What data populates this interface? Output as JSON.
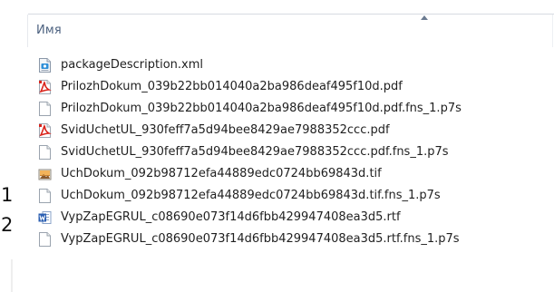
{
  "column_header": {
    "name_label": "Имя"
  },
  "side_numbers": [
    "1",
    "2"
  ],
  "files": [
    {
      "name": "packageDescription.xml",
      "icon": "xml-file-icon"
    },
    {
      "name": "PrilozhDokum_039b22bb014040a2ba986deaf495f10d.pdf",
      "icon": "pdf-file-icon"
    },
    {
      "name": "PrilozhDokum_039b22bb014040a2ba986deaf495f10d.pdf.fns_1.p7s",
      "icon": "blank-file-icon"
    },
    {
      "name": "SvidUchetUL_930feff7a5d94bee8429ae7988352ccc.pdf",
      "icon": "pdf-file-icon"
    },
    {
      "name": "SvidUchetUL_930feff7a5d94bee8429ae7988352ccc.pdf.fns_1.p7s",
      "icon": "blank-file-icon"
    },
    {
      "name": "UchDokum_092b98712efa44889edc0724bb69843d.tif",
      "icon": "image-file-icon"
    },
    {
      "name": "UchDokum_092b98712efa44889edc0724bb69843d.tif.fns_1.p7s",
      "icon": "blank-file-icon"
    },
    {
      "name": "VypZapEGRUL_c08690e073f14d6fbb429947408ea3d5.rtf",
      "icon": "word-file-icon"
    },
    {
      "name": "VypZapEGRUL_c08690e073f14d6fbb429947408ea3d5.rtf.fns_1.p7s",
      "icon": "blank-file-icon"
    }
  ]
}
